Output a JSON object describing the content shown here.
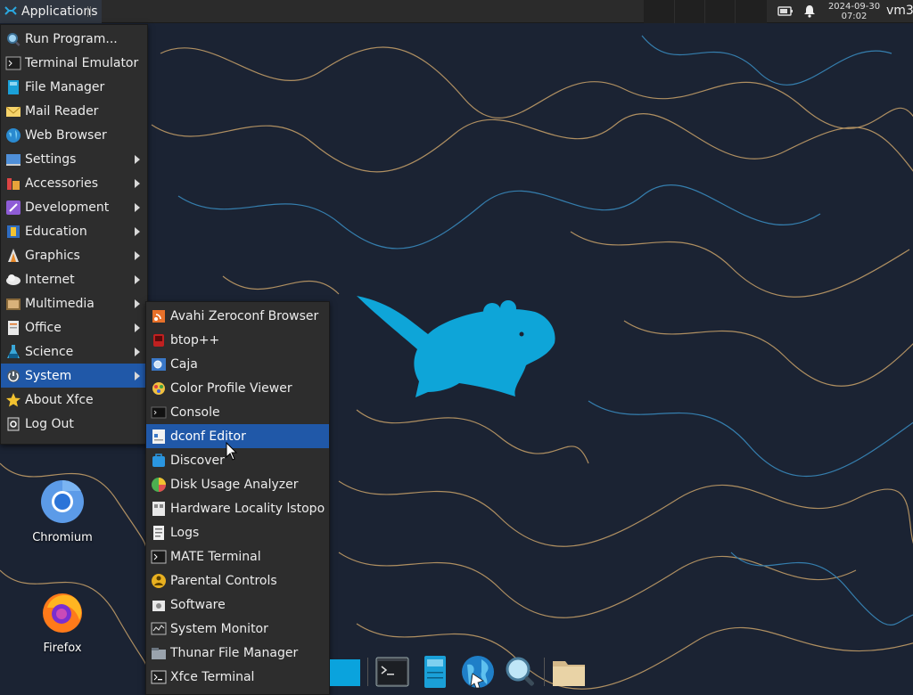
{
  "panel": {
    "applications_label": "Applications",
    "clock_date": "2024-09-30",
    "clock_time": "07:02",
    "user": "vm3"
  },
  "main_menu": [
    {
      "label": "Run Program...",
      "icon": "run-icon",
      "submenu": false
    },
    {
      "label": "Terminal Emulator",
      "icon": "terminal-icon",
      "submenu": false
    },
    {
      "label": "File Manager",
      "icon": "file-manager-icon",
      "submenu": false
    },
    {
      "label": "Mail Reader",
      "icon": "mail-icon",
      "submenu": false
    },
    {
      "label": "Web Browser",
      "icon": "web-browser-icon",
      "submenu": false
    },
    {
      "label": "Settings",
      "icon": "settings-icon",
      "submenu": true
    },
    {
      "label": "Accessories",
      "icon": "accessories-icon",
      "submenu": true
    },
    {
      "label": "Development",
      "icon": "development-icon",
      "submenu": true
    },
    {
      "label": "Education",
      "icon": "education-icon",
      "submenu": true
    },
    {
      "label": "Graphics",
      "icon": "graphics-icon",
      "submenu": true
    },
    {
      "label": "Internet",
      "icon": "internet-icon",
      "submenu": true
    },
    {
      "label": "Multimedia",
      "icon": "multimedia-icon",
      "submenu": true
    },
    {
      "label": "Office",
      "icon": "office-icon",
      "submenu": true
    },
    {
      "label": "Science",
      "icon": "science-icon",
      "submenu": true
    },
    {
      "label": "System",
      "icon": "system-icon",
      "submenu": true,
      "active": true
    },
    {
      "label": "About Xfce",
      "icon": "star-icon",
      "submenu": false
    },
    {
      "label": "Log Out",
      "icon": "logout-icon",
      "submenu": false
    }
  ],
  "system_submenu": [
    {
      "label": "Avahi Zeroconf Browser",
      "icon": "avahi-icon"
    },
    {
      "label": "btop++",
      "icon": "btop-icon"
    },
    {
      "label": "Caja",
      "icon": "caja-icon"
    },
    {
      "label": "Color Profile Viewer",
      "icon": "color-profile-icon"
    },
    {
      "label": "Console",
      "icon": "console-icon"
    },
    {
      "label": "dconf Editor",
      "icon": "dconf-icon",
      "active": true
    },
    {
      "label": "Discover",
      "icon": "discover-icon"
    },
    {
      "label": "Disk Usage Analyzer",
      "icon": "disk-usage-icon"
    },
    {
      "label": "Hardware Locality lstopo",
      "icon": "lstopo-icon"
    },
    {
      "label": "Logs",
      "icon": "logs-icon"
    },
    {
      "label": "MATE Terminal",
      "icon": "mate-terminal-icon"
    },
    {
      "label": "Parental Controls",
      "icon": "parental-controls-icon"
    },
    {
      "label": "Software",
      "icon": "software-icon"
    },
    {
      "label": "System Monitor",
      "icon": "system-monitor-icon"
    },
    {
      "label": "Thunar File Manager",
      "icon": "thunar-icon"
    },
    {
      "label": "Xfce Terminal",
      "icon": "xfce-terminal-icon"
    }
  ],
  "desktop": {
    "chromium_label": "Chromium",
    "firefox_label": "Firefox"
  },
  "dock": [
    {
      "name": "show-desktop-icon"
    },
    {
      "name": "terminal-icon"
    },
    {
      "name": "file-manager-icon"
    },
    {
      "name": "web-browser-icon"
    },
    {
      "name": "app-finder-icon"
    },
    {
      "name": "folder-icon"
    }
  ],
  "colors": {
    "menu_bg": "#2d2d2d",
    "highlight": "#2058a8",
    "panel": "#2b2b2b",
    "wallpaper": "#1b2333",
    "mouse": "#0ea5d8"
  }
}
